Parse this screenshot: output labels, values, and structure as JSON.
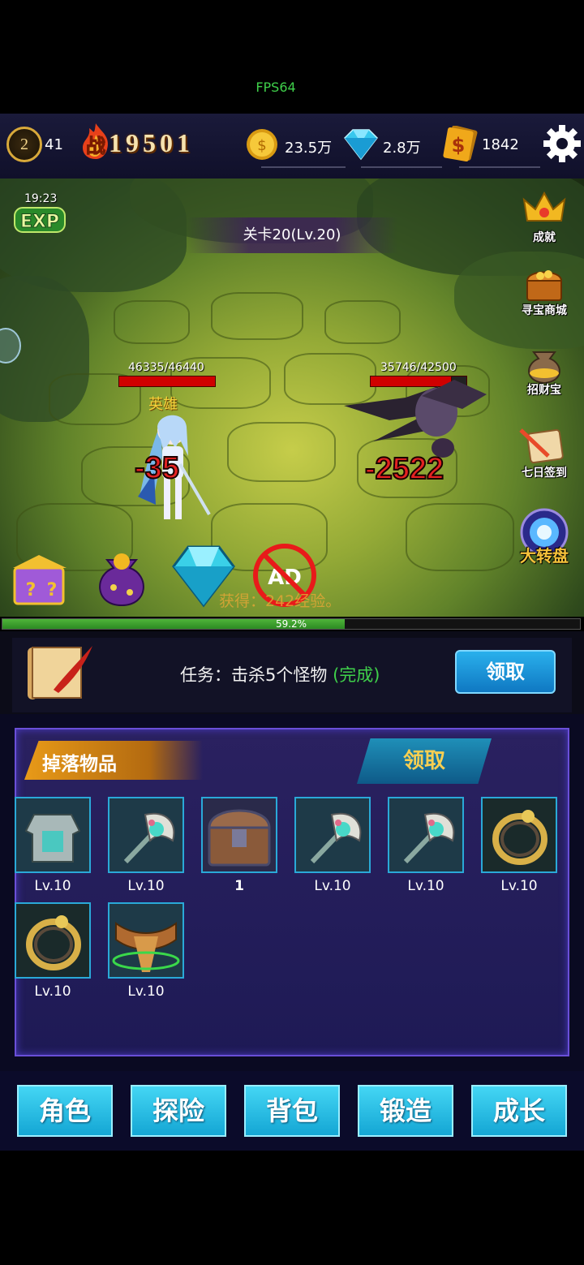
{
  "fps": "FPS64",
  "player": {
    "level": "2",
    "sub_level": "41",
    "power_prefix": "战",
    "power": "19501"
  },
  "resources": [
    {
      "icon": "gold-coin-icon",
      "value": "23.5万"
    },
    {
      "icon": "diamond-icon",
      "value": "2.8万"
    },
    {
      "icon": "dollar-card-icon",
      "value": "1842"
    }
  ],
  "battle": {
    "timer": "19:23",
    "exp_label": "EXP",
    "stage": "关卡20(Lv.20)",
    "hero": {
      "hp_text": "46335/46440",
      "hp": 46335,
      "hp_max": 46440,
      "name": "英雄",
      "damage": "-35"
    },
    "enemy": {
      "hp_text": "35746/42500",
      "hp": 35746,
      "hp_max": 42500,
      "damage": "-2522"
    },
    "side_buttons": [
      {
        "icon": "crown-icon",
        "label": "成就"
      },
      {
        "icon": "treasure-chest-icon",
        "label": "寻宝商城"
      },
      {
        "icon": "money-bag-icon",
        "label": "招财宝"
      },
      {
        "icon": "scroll-icon",
        "label": "七日签到"
      },
      {
        "icon": "orb-icon",
        "label": "大转盘"
      }
    ],
    "ad_label": "AD",
    "gain_text": "获得：242经验。"
  },
  "progress": {
    "value": 0.592,
    "label": "59.2%"
  },
  "quest": {
    "prefix": "任务：击杀5个怪物",
    "status": "(完成)",
    "claim": "领取"
  },
  "drops": {
    "title": "掉落物品",
    "claim": "领取",
    "items": [
      {
        "icon": "armor-icon",
        "label": "Lv.10"
      },
      {
        "icon": "axe-icon",
        "label": "Lv.10"
      },
      {
        "icon": "chest-icon",
        "label": "1"
      },
      {
        "icon": "axe-icon",
        "label": "Lv.10"
      },
      {
        "icon": "axe-icon",
        "label": "Lv.10"
      },
      {
        "icon": "ring-icon",
        "label": "Lv.10"
      },
      {
        "icon": "ring-icon",
        "label": "Lv.10"
      },
      {
        "icon": "belt-icon",
        "label": "Lv.10"
      }
    ]
  },
  "nav": [
    "角色",
    "探险",
    "背包",
    "锻造",
    "成长"
  ],
  "colors": {
    "accent": "#1fa8dc",
    "gold": "#f8cf52",
    "success": "#3fd04a",
    "hp": "#d00000"
  }
}
